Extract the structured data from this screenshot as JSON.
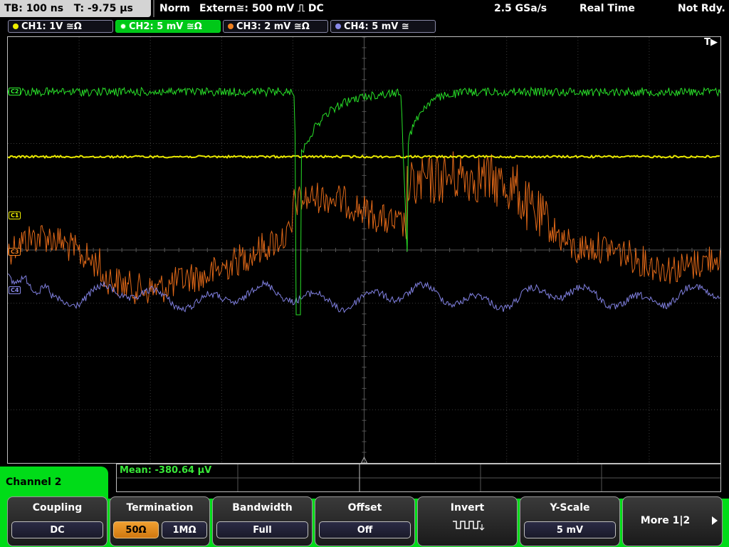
{
  "topbar": {
    "timebase": "TB: 100 ns",
    "trigger_time": "T: -9.75 µs",
    "mode": "Norm",
    "trigger_source": "Extern≅: 500 mV ⎍ DC",
    "sample_rate": "2.5 GSa/s",
    "acq_mode": "Real Time",
    "status": "Not Rdy."
  },
  "channels": [
    {
      "label": "CH1: 1V ≅Ω",
      "color": "#f0f000"
    },
    {
      "label": "CH2: 5 mV ≅Ω",
      "color": "#30f030"
    },
    {
      "label": "CH3: 2 mV ≅Ω",
      "color": "#f08020"
    },
    {
      "label": "CH4: 5 mV ≅",
      "color": "#8888e8"
    }
  ],
  "scope": {
    "trigger_marker": "T▶",
    "markers": [
      {
        "label": "C1",
        "color": "#f0f000"
      },
      {
        "label": "C3",
        "color": "#f08020"
      },
      {
        "label": "C4",
        "color": "#8888e8"
      },
      {
        "label": "C2",
        "color": "#30f030"
      }
    ]
  },
  "measurement": {
    "mean": "Mean: -380.64 µV"
  },
  "menu": {
    "title": "Channel 2",
    "coupling": {
      "title": "Coupling",
      "value": "DC"
    },
    "termination": {
      "title": "Termination",
      "option_50": "50Ω",
      "option_1m": "1MΩ",
      "selected": "50Ω"
    },
    "bandwidth": {
      "title": "Bandwidth",
      "value": "Full"
    },
    "offset": {
      "title": "Offset",
      "value": "Off"
    },
    "invert": {
      "title": "Invert",
      "icon": "inverted-square-wave-icon"
    },
    "yscale": {
      "title": "Y-Scale",
      "value": "5 mV"
    },
    "more": {
      "title": "More 1|2",
      "icon": "right-arrow-icon"
    }
  }
}
